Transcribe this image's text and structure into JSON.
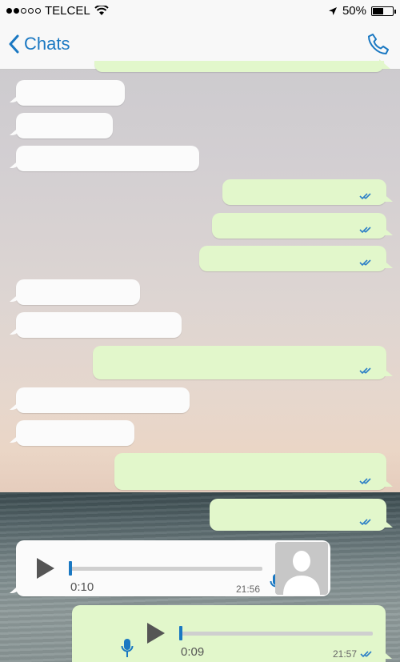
{
  "status_bar": {
    "carrier": "TELCEL",
    "battery_percent": "50%",
    "signal_bars_filled": 2,
    "signal_bars_total": 5
  },
  "nav": {
    "back_label": "Chats",
    "icons": [
      "chevron-left-icon",
      "phone-icon"
    ]
  },
  "colors": {
    "accent": "#1a78c2",
    "incoming_bubble": "#fbfbfb",
    "outgoing_bubble": "#e2f7cb",
    "read_ticks": "#2c7fc7"
  },
  "messages": [
    {
      "direction": "incoming",
      "text": ""
    },
    {
      "direction": "incoming",
      "text": ""
    },
    {
      "direction": "incoming",
      "text": ""
    },
    {
      "direction": "outgoing",
      "text": "",
      "status": "read"
    },
    {
      "direction": "outgoing",
      "text": "",
      "status": "read"
    },
    {
      "direction": "outgoing",
      "text": "",
      "status": "read"
    },
    {
      "direction": "incoming",
      "text": ""
    },
    {
      "direction": "incoming",
      "text": ""
    },
    {
      "direction": "outgoing",
      "text": "",
      "status": "read"
    },
    {
      "direction": "incoming",
      "text": ""
    },
    {
      "direction": "incoming",
      "text": ""
    },
    {
      "direction": "outgoing",
      "text": "",
      "status": "read"
    },
    {
      "direction": "outgoing",
      "text": "",
      "status": "read"
    }
  ],
  "voice_messages": [
    {
      "direction": "incoming",
      "duration": "0:10",
      "time": "21:56",
      "progress": 0.0
    },
    {
      "direction": "outgoing",
      "duration": "0:09",
      "time": "21:57",
      "progress": 0.0,
      "status": "read"
    }
  ]
}
